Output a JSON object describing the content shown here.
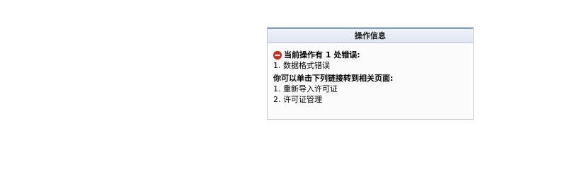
{
  "panel": {
    "title": "操作信息"
  },
  "error": {
    "icon": "error-stop-icon",
    "icon_color": "#d9291c",
    "heading": "当前操作有 1 处错误:",
    "items": [
      {
        "index": "1.",
        "text": "数据格式错误"
      }
    ]
  },
  "links": {
    "heading": "你可以单击下列链接转到相关页面:",
    "items": [
      {
        "index": "1.",
        "text": "重新导入许可证"
      },
      {
        "index": "2.",
        "text": "许可证管理"
      }
    ]
  }
}
